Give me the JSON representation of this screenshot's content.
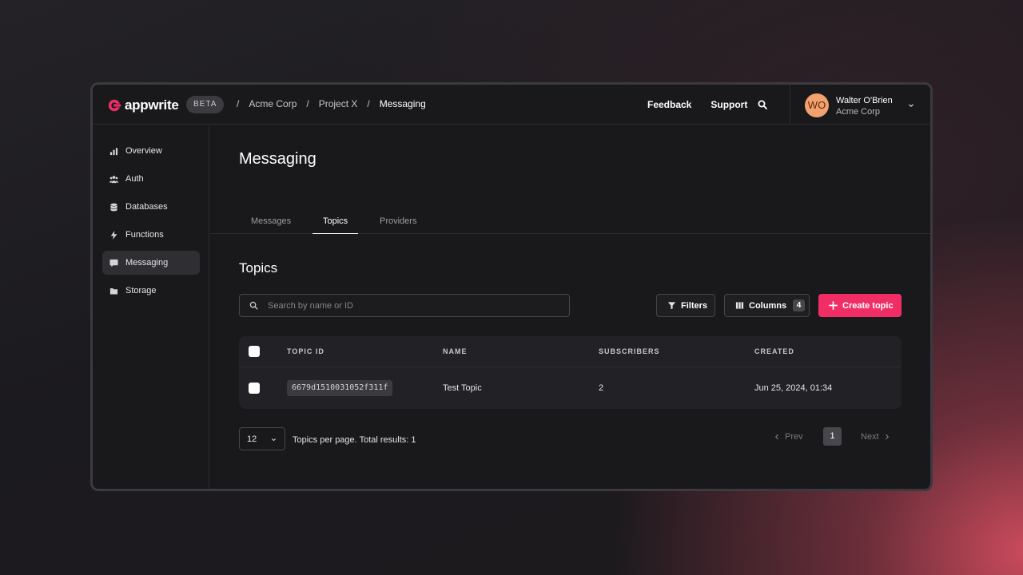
{
  "brand": {
    "name": "appwrite",
    "badge": "BETA",
    "accent": "#f02e65"
  },
  "breadcrumb": [
    "Acme Corp",
    "Project X",
    "Messaging"
  ],
  "header": {
    "feedback": "Feedback",
    "support": "Support"
  },
  "user": {
    "initials": "WO",
    "name": "Walter O'Brien",
    "org": "Acme Corp"
  },
  "sidebar": {
    "items": [
      {
        "label": "Overview",
        "icon": "bar-chart-icon"
      },
      {
        "label": "Auth",
        "icon": "users-icon"
      },
      {
        "label": "Databases",
        "icon": "database-icon"
      },
      {
        "label": "Functions",
        "icon": "lightning-icon"
      },
      {
        "label": "Messaging",
        "icon": "chat-icon",
        "active": true
      },
      {
        "label": "Storage",
        "icon": "folder-icon"
      }
    ]
  },
  "page": {
    "title": "Messaging",
    "tabs": [
      "Messages",
      "Topics",
      "Providers"
    ],
    "active_tab": "Topics",
    "section_title": "Topics"
  },
  "toolbar": {
    "search_placeholder": "Search by name or ID",
    "filters": "Filters",
    "columns": "Columns",
    "columns_count": "4",
    "create": "Create topic"
  },
  "table": {
    "headers": [
      "TOPIC ID",
      "NAME",
      "SUBSCRIBERS",
      "CREATED"
    ],
    "rows": [
      {
        "id": "6679d1510031052f311f",
        "name": "Test Topic",
        "subscribers": "2",
        "created": "Jun 25, 2024, 01:34"
      }
    ]
  },
  "pagination": {
    "per_page": "12",
    "summary": "Topics per page. Total results: 1",
    "prev": "Prev",
    "current": "1",
    "next": "Next"
  }
}
